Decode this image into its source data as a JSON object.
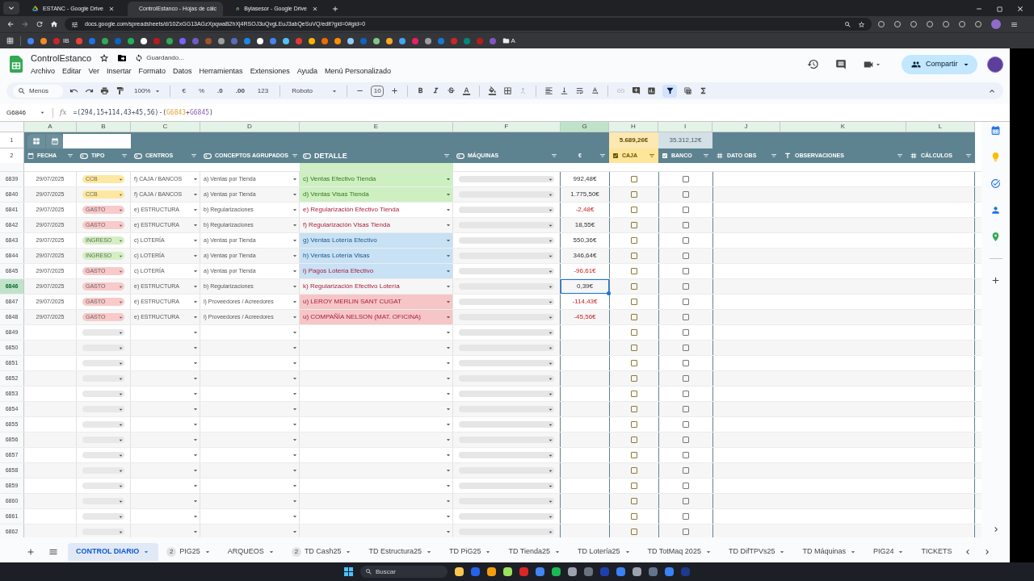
{
  "browser": {
    "tabs": [
      {
        "title": "ESTANC - Google Drive",
        "selected": false
      },
      {
        "title": "ControlEstanco - Hojas de cálc",
        "selected": true
      },
      {
        "title": "Bylasesor - Google Drive",
        "selected": false
      }
    ],
    "url": "docs.google.com/spreadsheets/d/10ZxGG13AGzXpqwaB2hXj4RSOJ3uQvgLEuJ3abQeSuVQ/edit?gid=0#gid=0",
    "bookmark_label": "IB",
    "folder_label": "A"
  },
  "doc": {
    "title": "ControlEstanco",
    "status": "Guardando...",
    "menus": [
      "Archivo",
      "Editar",
      "Ver",
      "Insertar",
      "Formato",
      "Datos",
      "Herramientas",
      "Extensiones",
      "Ayuda",
      "Menú Personalizado"
    ],
    "share": "Compartir"
  },
  "toolbar": {
    "search": "Menús",
    "zoom": "100%",
    "currency": "€",
    "percent": "%",
    "dec_less": ".0",
    "dec_more": ".00",
    "number_format": "123",
    "font": "Roboto",
    "font_size": "10",
    "filter_on": true
  },
  "formula_bar": {
    "cell": "G6846",
    "fx": "fx",
    "formula": [
      {
        "text": "=(294,15+114,43+45,56)-(",
        "kind": "plain"
      },
      {
        "text": "G6843",
        "kind": "reference"
      },
      {
        "text": "+",
        "kind": "plain"
      },
      {
        "text": "G6845",
        "kind": "reference"
      },
      {
        "text": ")",
        "kind": "plain"
      }
    ]
  },
  "frozen_rows": [
    "1",
    "2"
  ],
  "columns": [
    {
      "letter": "A",
      "selected": false
    },
    {
      "letter": "B",
      "selected": false
    },
    {
      "letter": "C",
      "selected": false
    },
    {
      "letter": "D",
      "selected": false
    },
    {
      "letter": "E",
      "selected": false
    },
    {
      "letter": "F",
      "selected": false
    },
    {
      "letter": "G",
      "selected": true
    },
    {
      "letter": "H",
      "selected": false
    },
    {
      "letter": "I",
      "selected": false
    },
    {
      "letter": "J",
      "selected": false
    },
    {
      "letter": "K",
      "selected": false
    },
    {
      "letter": "L",
      "selected": false
    }
  ],
  "totals": [
    {
      "text": "5.689,26€",
      "color": "#fce8b2"
    },
    {
      "text": "35.312,12€",
      "color": "#d3e0e5"
    }
  ],
  "headers": [
    {
      "label": "FECHA",
      "kind": "date"
    },
    {
      "label": "TIPO",
      "kind": "dropdown"
    },
    {
      "label": "CENTROS",
      "kind": "dropdown"
    },
    {
      "label": "CONCEPTOS AGRUPADOS",
      "kind": "dropdown"
    },
    {
      "label": "DETALLE",
      "kind": "dropdown"
    },
    {
      "label": "MÁQUINAS",
      "kind": "dropdown"
    },
    {
      "label": "€",
      "kind": "plain"
    },
    {
      "label": "CAJA",
      "kind": "checkbox",
      "color": "#fde59a"
    },
    {
      "label": "BANCO",
      "kind": "checkbox"
    },
    {
      "label": "DATO OBS",
      "kind": "number"
    },
    {
      "label": "OBSERVACIONES",
      "kind": "text"
    },
    {
      "label": "CÁLCULOS",
      "kind": "number"
    }
  ],
  "rows": [
    {
      "kind": "entry",
      "num": "6839",
      "selected": false,
      "fecha": "29/07/2025",
      "tipo": {
        "label": "CCB",
        "color": "#fce8a0"
      },
      "centro": "f) CAJA / BANCOS",
      "concepto": "a) Ventas por Tienda",
      "detalle": {
        "text": "c) Ventas Efectivo Tienda",
        "kind": "sale",
        "color": "#cdefc1"
      },
      "importe": "992,48€",
      "negative": false,
      "caja": false,
      "banco": false
    },
    {
      "kind": "entry",
      "num": "6840",
      "selected": false,
      "fecha": "29/07/2025",
      "tipo": {
        "label": "CCB",
        "color": "#fce8a0"
      },
      "centro": "f) CAJA / BANCOS",
      "concepto": "a) Ventas por Tienda",
      "detalle": {
        "text": "d) Ventas Visas Tienda",
        "kind": "sale",
        "color": "#cdefc1"
      },
      "importe": "1.775,50€",
      "negative": false,
      "caja": false,
      "banco": false
    },
    {
      "kind": "entry",
      "num": "6841",
      "selected": false,
      "fecha": "29/07/2025",
      "tipo": {
        "label": "GASTO",
        "color": "#f8caca"
      },
      "centro": "e) ESTRUCTURA",
      "concepto": "b) Regularizaciones",
      "detalle": {
        "text": "e) Regularización Efectivo Tienda",
        "kind": "expense"
      },
      "importe": "-2,48€",
      "negative": true,
      "caja": false,
      "banco": false
    },
    {
      "kind": "entry",
      "num": "6842",
      "selected": false,
      "fecha": "29/07/2025",
      "tipo": {
        "label": "GASTO",
        "color": "#f8caca"
      },
      "centro": "e) ESTRUCTURA",
      "concepto": "b) Regularizaciones",
      "detalle": {
        "text": "f) Regularización Visas Tienda",
        "kind": "expense"
      },
      "importe": "18,55€",
      "negative": false,
      "caja": false,
      "banco": false
    },
    {
      "kind": "entry",
      "num": "6843",
      "selected": false,
      "fecha": "29/07/2025",
      "tipo": {
        "label": "INGRESO",
        "color": "#d4efc4"
      },
      "centro": "c) LOTERÍA",
      "concepto": "a) Ventas por Tienda",
      "detalle": {
        "text": "g) Ventas Lotería Efectivo",
        "kind": "lottery",
        "color": "#c8e1f4"
      },
      "importe": "550,36€",
      "negative": false,
      "caja": false,
      "banco": false
    },
    {
      "kind": "entry",
      "num": "6844",
      "selected": false,
      "fecha": "29/07/2025",
      "tipo": {
        "label": "INGRESO",
        "color": "#d4efc4"
      },
      "centro": "c) LOTERÍA",
      "concepto": "a) Ventas por Tienda",
      "detalle": {
        "text": "h) Ventas Lotería Visas",
        "kind": "lottery",
        "color": "#c8e1f4"
      },
      "importe": "346,64€",
      "negative": false,
      "caja": false,
      "banco": false
    },
    {
      "kind": "entry",
      "num": "6845",
      "selected": false,
      "fecha": "29/07/2025",
      "tipo": {
        "label": "GASTO",
        "color": "#f8caca"
      },
      "centro": "c) LOTERÍA",
      "concepto": "a) Ventas por Tienda",
      "detalle": {
        "text": "i) Pagos Lotería Efectivo",
        "kind": "expense",
        "color": "#c8e1f4"
      },
      "importe": "-96,61€",
      "negative": true,
      "caja": false,
      "banco": false
    },
    {
      "kind": "entry",
      "num": "6846",
      "selected": true,
      "fecha": "29/07/2025",
      "tipo": {
        "label": "GASTO",
        "color": "#f8caca"
      },
      "centro": "e) ESTRUCTURA",
      "concepto": "b) Regularizaciones",
      "detalle": {
        "text": "k) Regularización Efectivo Lotería",
        "kind": "expense"
      },
      "importe": "0,39€",
      "negative": false,
      "caja": false,
      "banco": false
    },
    {
      "kind": "entry",
      "num": "6847",
      "selected": false,
      "fecha": "29/07/2025",
      "tipo": {
        "label": "GASTO",
        "color": "#f8caca"
      },
      "centro": "e) ESTRUCTURA",
      "concepto": "i) Proveedores / Acreedores",
      "detalle": {
        "text": "u) LEROY MERLIN SANT CUGAT",
        "kind": "expense",
        "color": "#f6c6c6"
      },
      "importe": "-114,43€",
      "negative": true,
      "caja": false,
      "banco": false
    },
    {
      "kind": "entry",
      "num": "6848",
      "selected": false,
      "fecha": "29/07/2025",
      "tipo": {
        "label": "GASTO",
        "color": "#f8caca"
      },
      "centro": "e) ESTRUCTURA",
      "concepto": "i) Proveedores / Acreedores",
      "detalle": {
        "text": "u) COMPAÑÍA NELSON (MAT. OFICINA)",
        "kind": "expense",
        "color": "#f6c6c6"
      },
      "importe": "-45,56€",
      "negative": true,
      "caja": false,
      "banco": false
    },
    {
      "kind": "blank",
      "num": "6849",
      "selected": false,
      "caja": false,
      "banco": false
    },
    {
      "kind": "blank",
      "num": "6850",
      "selected": false,
      "caja": false,
      "banco": false
    },
    {
      "kind": "blank",
      "num": "6851",
      "selected": false,
      "caja": false,
      "banco": false
    },
    {
      "kind": "blank",
      "num": "6852",
      "selected": false,
      "caja": false,
      "banco": false
    },
    {
      "kind": "blank",
      "num": "6853",
      "selected": false,
      "caja": false,
      "banco": false
    },
    {
      "kind": "blank",
      "num": "6854",
      "selected": false,
      "caja": false,
      "banco": false
    },
    {
      "kind": "blank",
      "num": "6855",
      "selected": false,
      "caja": false,
      "banco": false
    },
    {
      "kind": "blank",
      "num": "6856",
      "selected": false,
      "caja": false,
      "banco": false
    },
    {
      "kind": "blank",
      "num": "6857",
      "selected": false,
      "caja": false,
      "banco": false
    },
    {
      "kind": "blank",
      "num": "6858",
      "selected": false,
      "caja": false,
      "banco": false
    },
    {
      "kind": "blank",
      "num": "6859",
      "selected": false,
      "caja": false,
      "banco": false
    },
    {
      "kind": "blank",
      "num": "6860",
      "selected": false,
      "caja": false,
      "banco": false
    },
    {
      "kind": "blank",
      "num": "6861",
      "selected": false,
      "caja": false,
      "banco": false
    },
    {
      "kind": "blank",
      "num": "6862",
      "selected": false,
      "caja": false,
      "banco": false
    }
  ],
  "sheet_tabs": [
    {
      "label": "CONTROL DIARIO",
      "selected": true
    },
    {
      "label": "PIG25",
      "badge": "2",
      "selected": false
    },
    {
      "label": "ARQUEOS",
      "selected": false
    },
    {
      "label": "TD Cash25",
      "badge": "2",
      "selected": false
    },
    {
      "label": "TD Estructura25",
      "selected": false
    },
    {
      "label": "TD PiG25",
      "selected": false
    },
    {
      "label": "TD Tienda25",
      "selected": false
    },
    {
      "label": "TD Lotería25",
      "selected": false
    },
    {
      "label": "TD TotMaq 2025",
      "selected": false
    },
    {
      "label": "TD DifTPVs25",
      "selected": false
    },
    {
      "label": "TD Máquinas",
      "selected": false
    },
    {
      "label": "PIG24",
      "selected": false
    },
    {
      "label": "TICKETS",
      "selected": false
    }
  ],
  "taskbar": {
    "search": "Buscar"
  }
}
